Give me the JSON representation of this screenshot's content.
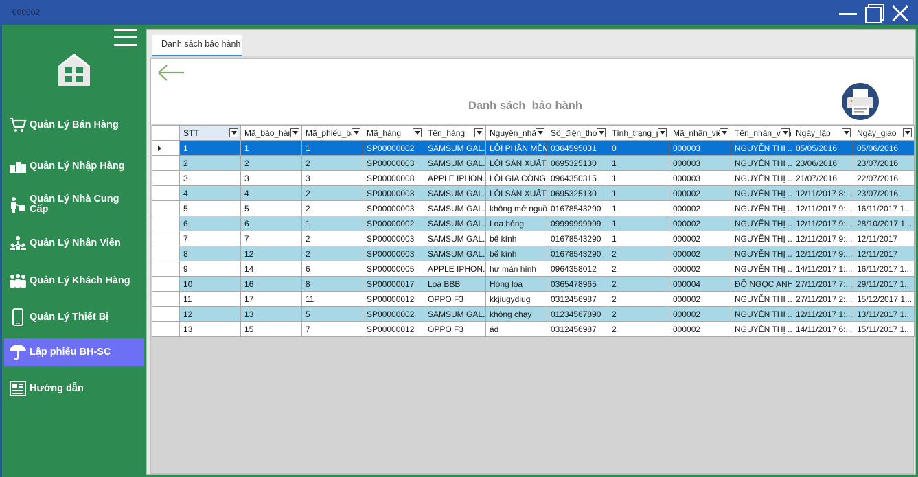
{
  "window": {
    "title": "000002"
  },
  "sidebar": {
    "items": [
      {
        "label": "Quản Lý Bán Hàng",
        "icon": "cart-icon"
      },
      {
        "label": "Quản Lý Nhập Hàng",
        "icon": "warehouse-icon"
      },
      {
        "label": "Quản Lý Nhà Cung Cấp",
        "icon": "supplier-icon"
      },
      {
        "label": "Quản Lý Nhân Viên",
        "icon": "staff-icon"
      },
      {
        "label": "Quản Lý Khách Hàng",
        "icon": "customers-icon"
      },
      {
        "label": "Quản Lý Thiết Bị",
        "icon": "phone-icon"
      },
      {
        "label": "Lập phiếu BH-SC",
        "icon": "umbrella-icon"
      },
      {
        "label": "Hướng dẫn",
        "icon": "guide-icon"
      }
    ],
    "active": "Lập phiếu BH-SC"
  },
  "tab": {
    "label": "Danh sách bảo hành"
  },
  "page": {
    "title": "Danh sách  bảo hành"
  },
  "grid": {
    "columns": [
      "STT",
      "Mã_bảo_hành",
      "Mã_phiếu_bán",
      "Mã_hàng",
      "Tên_hàng",
      "Nguyên_nhân",
      "Số_điện_thoại",
      "Tình_trạng_p",
      "Mã_nhân_viên",
      "Tên_nhân_viên",
      "Ngày_lập",
      "Ngày_giao"
    ],
    "rows": [
      [
        "1",
        "1",
        "1",
        "SP00000002",
        "SAMSUM GAL...",
        "LỖI PHẦN MỀM",
        "0364595031",
        "0",
        "000003",
        "NGUYỄN THỊ ...",
        "05/05/2016",
        "05/06/2016"
      ],
      [
        "2",
        "2",
        "2",
        "SP00000003",
        "SAMSUM GAL...",
        "LỖI SẢN XUẤT",
        "0695325130",
        "1",
        "000003",
        "NGUYỄN THỊ ...",
        "23/06/2016",
        "23/07/2016"
      ],
      [
        "3",
        "3",
        "3",
        "SP00000008",
        "APPLE IPHON...",
        "LỖI GIA CÔNG",
        "0964350315",
        "1",
        "000003",
        "NGUYỄN THỊ ...",
        "21/07/2016",
        "22/07/2016"
      ],
      [
        "4",
        "4",
        "2",
        "SP00000003",
        "SAMSUM GAL...",
        "LỖI SẢN XUẤT",
        "0695325130",
        "1",
        "000002",
        "NGUYỄN THỊ ...",
        "12/11/2017 8:...",
        "23/07/2016"
      ],
      [
        "5",
        "5",
        "2",
        "SP00000003",
        "SAMSUM GAL...",
        "không mở nguồn",
        "01678543290",
        "1",
        "000002",
        "NGUYỄN THỊ ...",
        "12/11/2017 9:...",
        "16/11/2017 1..."
      ],
      [
        "6",
        "6",
        "1",
        "SP00000002",
        "SAMSUM GAL...",
        "Loa hỏng",
        "09999999999",
        "1",
        "000002",
        "NGUYỄN THỊ ...",
        "12/11/2017 9:...",
        "28/10/2017 1..."
      ],
      [
        "7",
        "7",
        "2",
        "SP00000003",
        "SAMSUM GAL...",
        "bể kính",
        "01678543290",
        "1",
        "000002",
        "NGUYỄN THỊ ...",
        "12/11/2017 9:...",
        "12/11/2017"
      ],
      [
        "8",
        "12",
        "2",
        "SP00000003",
        "SAMSUM GAL...",
        "bể kính",
        "01678543290",
        "2",
        "000002",
        "NGUYỄN THỊ ...",
        "12/11/2017 9:...",
        "12/11/2017"
      ],
      [
        "9",
        "14",
        "6",
        "SP00000005",
        "APPLE IPHON...",
        "hư màn hình",
        "0964358012",
        "2",
        "000002",
        "NGUYỄN THỊ ...",
        "14/11/2017 1:...",
        "16/11/2017 1..."
      ],
      [
        "10",
        "16",
        "8",
        "SP00000017",
        "Loa BBB",
        "Hỏng loa",
        "0365478965",
        "2",
        "000004",
        "ĐỖ NGỌC ANH",
        "27/11/2017 7:...",
        "29/11/2017 1..."
      ],
      [
        "11",
        "17",
        "11",
        "SP00000012",
        "OPPO F3",
        "kkjiugydiug",
        "0312456987",
        "2",
        "000002",
        "NGUYỄN THỊ ...",
        "27/11/2017 2:...",
        "15/12/2017 1..."
      ],
      [
        "12",
        "13",
        "5",
        "SP00000002",
        "SAMSUM GAL...",
        "không chạy",
        "01234567890",
        "2",
        "000002",
        "NGUYỄN THỊ ...",
        "12/11/2017 1:...",
        "13/11/2017 1..."
      ],
      [
        "13",
        "15",
        "7",
        "SP00000012",
        "OPPO F3",
        "ád",
        "0312456987",
        "2",
        "000002",
        "NGUYỄN THỊ ...",
        "14/11/2017 6:...",
        "15/11/2017 1..."
      ]
    ],
    "selected_row": 0
  },
  "colors": {
    "titlebar": "#2b56a8",
    "sidebar": "#2d8a50",
    "sidebar_active": "#6d6ff4",
    "row_alt": "#a8d8e6",
    "row_selected": "#0a74d4",
    "back_arrow": "#7fa86a"
  }
}
